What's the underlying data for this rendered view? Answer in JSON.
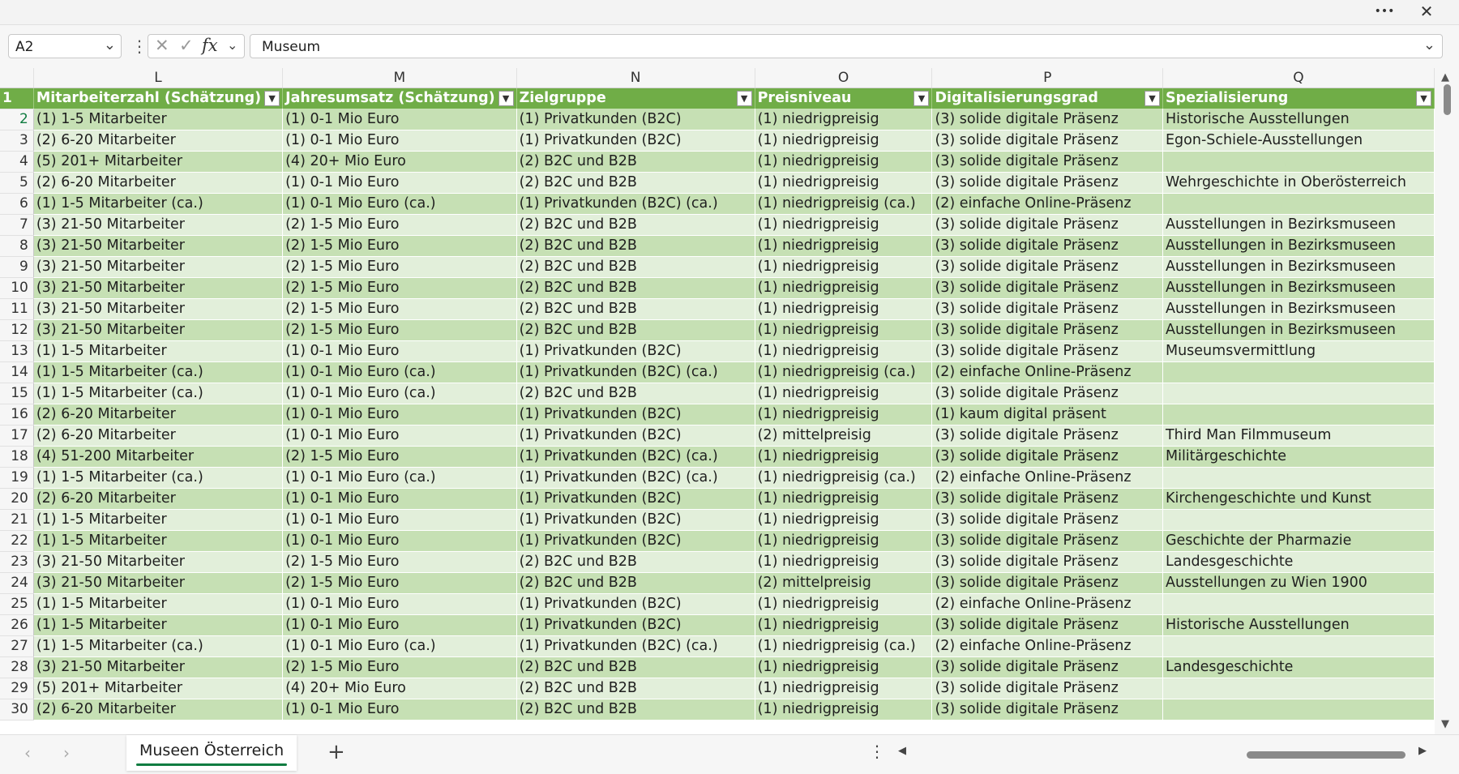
{
  "window": {
    "more_glyph": "•••",
    "close_glyph": "✕"
  },
  "formula_bar": {
    "name_box": "A2",
    "dropdown_glyph": "⌄",
    "options_glyph": "⋮",
    "cancel_glyph": "✕",
    "enter_glyph": "✓",
    "fx_glyph": "fx",
    "value": "Museum"
  },
  "columns": [
    "L",
    "M",
    "N",
    "O",
    "P",
    "Q"
  ],
  "table_headers": [
    "Mitarbeiterzahl (Schätzung)",
    "Jahresumsatz (Schätzung)",
    "Zielgruppe",
    "Preisniveau",
    "Digitalisierungsgrad",
    "Spezialisierung"
  ],
  "filter_glyph": "▼",
  "rows": [
    {
      "n": "2",
      "cells": [
        "(1) 1-5 Mitarbeiter",
        "(1) 0-1 Mio Euro",
        "(1) Privatkunden (B2C)",
        "(1) niedrigpreisig",
        "(3) solide digitale Präsenz",
        "Historische Ausstellungen"
      ]
    },
    {
      "n": "3",
      "cells": [
        "(2) 6-20 Mitarbeiter",
        "(1) 0-1 Mio Euro",
        "(1) Privatkunden (B2C)",
        "(1) niedrigpreisig",
        "(3) solide digitale Präsenz",
        "Egon-Schiele-Ausstellungen"
      ]
    },
    {
      "n": "4",
      "cells": [
        "(5) 201+ Mitarbeiter",
        "(4) 20+ Mio Euro",
        "(2) B2C und B2B",
        "(1) niedrigpreisig",
        "(3) solide digitale Präsenz",
        ""
      ]
    },
    {
      "n": "5",
      "cells": [
        "(2) 6-20 Mitarbeiter",
        "(1) 0-1 Mio Euro",
        "(2) B2C und B2B",
        "(1) niedrigpreisig",
        "(3) solide digitale Präsenz",
        "Wehrgeschichte in Oberösterreich"
      ]
    },
    {
      "n": "6",
      "cells": [
        "(1) 1-5 Mitarbeiter (ca.)",
        "(1) 0-1 Mio Euro (ca.)",
        "(1) Privatkunden (B2C) (ca.)",
        "(1) niedrigpreisig (ca.)",
        "(2) einfache Online-Präsenz",
        ""
      ]
    },
    {
      "n": "7",
      "cells": [
        "(3) 21-50 Mitarbeiter",
        "(2) 1-5 Mio Euro",
        "(2) B2C und B2B",
        "(1) niedrigpreisig",
        "(3) solide digitale Präsenz",
        "Ausstellungen in Bezirksmuseen"
      ]
    },
    {
      "n": "8",
      "cells": [
        "(3) 21-50 Mitarbeiter",
        "(2) 1-5 Mio Euro",
        "(2) B2C und B2B",
        "(1) niedrigpreisig",
        "(3) solide digitale Präsenz",
        "Ausstellungen in Bezirksmuseen"
      ]
    },
    {
      "n": "9",
      "cells": [
        "(3) 21-50 Mitarbeiter",
        "(2) 1-5 Mio Euro",
        "(2) B2C und B2B",
        "(1) niedrigpreisig",
        "(3) solide digitale Präsenz",
        "Ausstellungen in Bezirksmuseen"
      ]
    },
    {
      "n": "10",
      "cells": [
        "(3) 21-50 Mitarbeiter",
        "(2) 1-5 Mio Euro",
        "(2) B2C und B2B",
        "(1) niedrigpreisig",
        "(3) solide digitale Präsenz",
        "Ausstellungen in Bezirksmuseen"
      ]
    },
    {
      "n": "11",
      "cells": [
        "(3) 21-50 Mitarbeiter",
        "(2) 1-5 Mio Euro",
        "(2) B2C und B2B",
        "(1) niedrigpreisig",
        "(3) solide digitale Präsenz",
        "Ausstellungen in Bezirksmuseen"
      ]
    },
    {
      "n": "12",
      "cells": [
        "(3) 21-50 Mitarbeiter",
        "(2) 1-5 Mio Euro",
        "(2) B2C und B2B",
        "(1) niedrigpreisig",
        "(3) solide digitale Präsenz",
        "Ausstellungen in Bezirksmuseen"
      ]
    },
    {
      "n": "13",
      "cells": [
        "(1) 1-5 Mitarbeiter",
        "(1) 0-1 Mio Euro",
        "(1) Privatkunden (B2C)",
        "(1) niedrigpreisig",
        "(3) solide digitale Präsenz",
        "Museumsvermittlung"
      ]
    },
    {
      "n": "14",
      "cells": [
        "(1) 1-5 Mitarbeiter (ca.)",
        "(1) 0-1 Mio Euro (ca.)",
        "(1) Privatkunden (B2C) (ca.)",
        "(1) niedrigpreisig (ca.)",
        "(2) einfache Online-Präsenz",
        ""
      ]
    },
    {
      "n": "15",
      "cells": [
        "(1) 1-5 Mitarbeiter (ca.)",
        "(1) 0-1 Mio Euro (ca.)",
        "(2) B2C und B2B",
        "(1) niedrigpreisig",
        "(3) solide digitale Präsenz",
        ""
      ]
    },
    {
      "n": "16",
      "cells": [
        "(2) 6-20 Mitarbeiter",
        "(1) 0-1 Mio Euro",
        "(1) Privatkunden (B2C)",
        "(1) niedrigpreisig",
        "(1) kaum digital präsent",
        ""
      ]
    },
    {
      "n": "17",
      "cells": [
        "(2) 6-20 Mitarbeiter",
        "(1) 0-1 Mio Euro",
        "(1) Privatkunden (B2C)",
        "(2) mittelpreisig",
        "(3) solide digitale Präsenz",
        "Third Man Filmmuseum"
      ]
    },
    {
      "n": "18",
      "cells": [
        "(4) 51-200 Mitarbeiter",
        "(2) 1-5 Mio Euro",
        "(1) Privatkunden (B2C) (ca.)",
        "(1) niedrigpreisig",
        "(3) solide digitale Präsenz",
        "Militärgeschichte"
      ]
    },
    {
      "n": "19",
      "cells": [
        "(1) 1-5 Mitarbeiter (ca.)",
        "(1) 0-1 Mio Euro (ca.)",
        "(1) Privatkunden (B2C) (ca.)",
        "(1) niedrigpreisig (ca.)",
        "(2) einfache Online-Präsenz",
        ""
      ]
    },
    {
      "n": "20",
      "cells": [
        "(2) 6-20 Mitarbeiter",
        "(1) 0-1 Mio Euro",
        "(1) Privatkunden (B2C)",
        "(1) niedrigpreisig",
        "(3) solide digitale Präsenz",
        "Kirchengeschichte und Kunst"
      ]
    },
    {
      "n": "21",
      "cells": [
        "(1) 1-5 Mitarbeiter",
        "(1) 0-1 Mio Euro",
        "(1) Privatkunden (B2C)",
        "(1) niedrigpreisig",
        "(3) solide digitale Präsenz",
        ""
      ]
    },
    {
      "n": "22",
      "cells": [
        "(1) 1-5 Mitarbeiter",
        "(1) 0-1 Mio Euro",
        "(1) Privatkunden (B2C)",
        "(1) niedrigpreisig",
        "(3) solide digitale Präsenz",
        "Geschichte der Pharmazie"
      ]
    },
    {
      "n": "23",
      "cells": [
        "(3) 21-50 Mitarbeiter",
        "(2) 1-5 Mio Euro",
        "(2) B2C und B2B",
        "(1) niedrigpreisig",
        "(3) solide digitale Präsenz",
        "Landesgeschichte"
      ]
    },
    {
      "n": "24",
      "cells": [
        "(3) 21-50 Mitarbeiter",
        "(2) 1-5 Mio Euro",
        "(2) B2C und B2B",
        "(2) mittelpreisig",
        "(3) solide digitale Präsenz",
        "Ausstellungen zu Wien 1900"
      ]
    },
    {
      "n": "25",
      "cells": [
        "(1) 1-5 Mitarbeiter",
        "(1) 0-1 Mio Euro",
        "(1) Privatkunden (B2C)",
        "(1) niedrigpreisig",
        "(2) einfache Online-Präsenz",
        ""
      ]
    },
    {
      "n": "26",
      "cells": [
        "(1) 1-5 Mitarbeiter",
        "(1) 0-1 Mio Euro",
        "(1) Privatkunden (B2C)",
        "(1) niedrigpreisig",
        "(3) solide digitale Präsenz",
        "Historische Ausstellungen"
      ]
    },
    {
      "n": "27",
      "cells": [
        "(1) 1-5 Mitarbeiter (ca.)",
        "(1) 0-1 Mio Euro (ca.)",
        "(1) Privatkunden (B2C) (ca.)",
        "(1) niedrigpreisig (ca.)",
        "(2) einfache Online-Präsenz",
        ""
      ]
    },
    {
      "n": "28",
      "cells": [
        "(3) 21-50 Mitarbeiter",
        "(2) 1-5 Mio Euro",
        "(2) B2C und B2B",
        "(1) niedrigpreisig",
        "(3) solide digitale Präsenz",
        "Landesgeschichte"
      ]
    },
    {
      "n": "29",
      "cells": [
        "(5) 201+ Mitarbeiter",
        "(4) 20+ Mio Euro",
        "(2) B2C und B2B",
        "(1) niedrigpreisig",
        "(3) solide digitale Präsenz",
        ""
      ]
    },
    {
      "n": "30",
      "cells": [
        "(2) 6-20 Mitarbeiter",
        "(1) 0-1 Mio Euro",
        "(2) B2C und B2B",
        "(1) niedrigpreisig",
        "(3) solide digitale Präsenz",
        ""
      ]
    }
  ],
  "sheet_tabs": {
    "prev_glyph": "‹",
    "next_glyph": "›",
    "active": "Museen Österreich",
    "add_glyph": "+",
    "more_glyph": "⋮"
  },
  "scroll": {
    "up_glyph": "▲",
    "down_glyph": "▼",
    "left_glyph": "◀",
    "right_glyph": "▶"
  },
  "colors": {
    "header": "#70ad47",
    "band_dark": "#c6e0b4",
    "band_light": "#e2efda",
    "accent": "#107c41"
  }
}
